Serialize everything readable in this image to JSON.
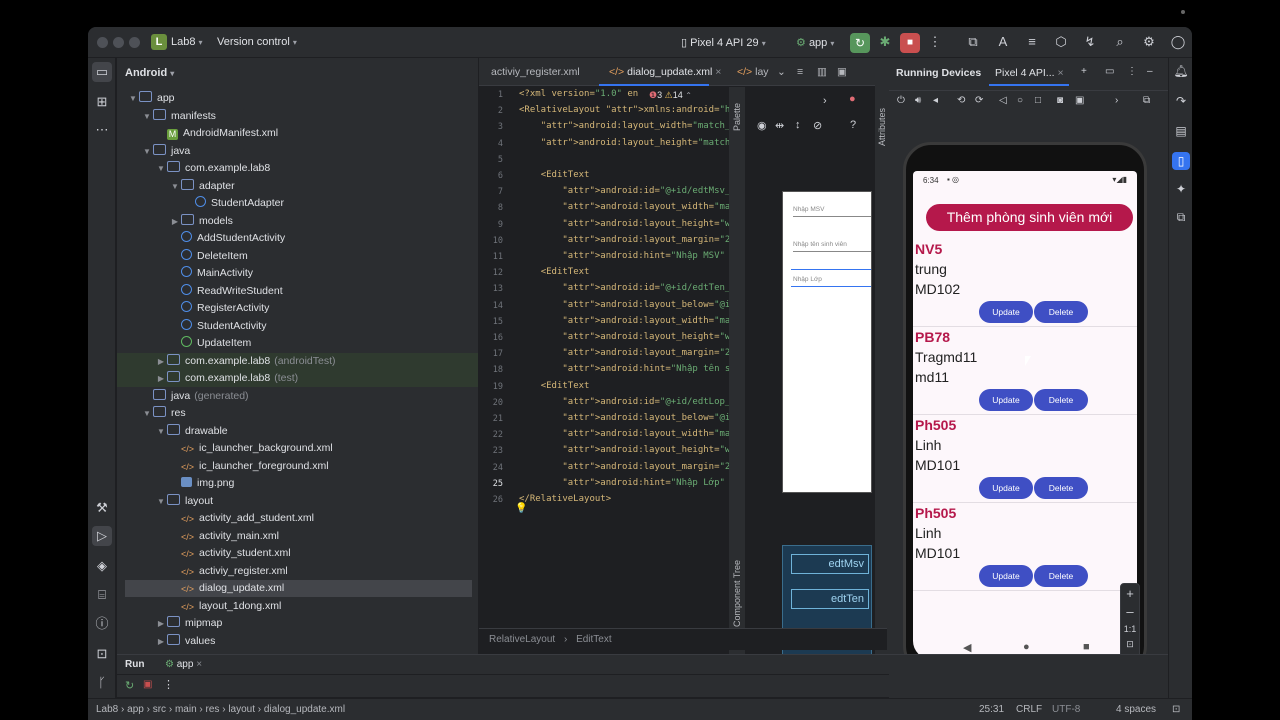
{
  "titlebar": {
    "project_badge": "L",
    "project_name": "Lab8",
    "vcs": "Version control",
    "device": "Pixel 4 API 29",
    "run_config": "app"
  },
  "project_panel": {
    "view": "Android",
    "tree": [
      {
        "label": "app",
        "suffix": "",
        "indent": 0,
        "icon": "folder",
        "arrow": "down"
      },
      {
        "label": "manifests",
        "suffix": "",
        "indent": 1,
        "icon": "folder",
        "arrow": "down"
      },
      {
        "label": "AndroidManifest.xml",
        "suffix": "",
        "indent": 2,
        "icon": "manifest",
        "arrow": ""
      },
      {
        "label": "java",
        "suffix": "",
        "indent": 1,
        "icon": "folder",
        "arrow": "down"
      },
      {
        "label": "com.example.lab8",
        "suffix": "",
        "indent": 2,
        "icon": "folder",
        "arrow": "down"
      },
      {
        "label": "adapter",
        "suffix": "",
        "indent": 3,
        "icon": "folder",
        "arrow": "down"
      },
      {
        "label": "StudentAdapter",
        "suffix": "",
        "indent": 4,
        "icon": "class",
        "arrow": ""
      },
      {
        "label": "models",
        "suffix": "",
        "indent": 3,
        "icon": "folder",
        "arrow": "right"
      },
      {
        "label": "AddStudentActivity",
        "suffix": "",
        "indent": 3,
        "icon": "class",
        "arrow": ""
      },
      {
        "label": "DeleteItem",
        "suffix": "",
        "indent": 3,
        "icon": "class",
        "arrow": ""
      },
      {
        "label": "MainActivity",
        "suffix": "",
        "indent": 3,
        "icon": "class",
        "arrow": ""
      },
      {
        "label": "ReadWriteStudent",
        "suffix": "",
        "indent": 3,
        "icon": "class",
        "arrow": ""
      },
      {
        "label": "RegisterActivity",
        "suffix": "",
        "indent": 3,
        "icon": "class",
        "arrow": ""
      },
      {
        "label": "StudentActivity",
        "suffix": "",
        "indent": 3,
        "icon": "class",
        "arrow": ""
      },
      {
        "label": "UpdateItem",
        "suffix": "",
        "indent": 3,
        "icon": "activity",
        "arrow": ""
      },
      {
        "label": "com.example.lab8",
        "suffix": "(androidTest)",
        "indent": 2,
        "icon": "folder",
        "arrow": "right",
        "test": true
      },
      {
        "label": "com.example.lab8",
        "suffix": "(test)",
        "indent": 2,
        "icon": "folder",
        "arrow": "right",
        "test": true
      },
      {
        "label": "java",
        "suffix": "(generated)",
        "indent": 1,
        "icon": "folder",
        "arrow": ""
      },
      {
        "label": "res",
        "suffix": "",
        "indent": 1,
        "icon": "folder",
        "arrow": "down"
      },
      {
        "label": "drawable",
        "suffix": "",
        "indent": 2,
        "icon": "folder",
        "arrow": "down"
      },
      {
        "label": "ic_launcher_background.xml",
        "suffix": "",
        "indent": 3,
        "icon": "xml",
        "arrow": ""
      },
      {
        "label": "ic_launcher_foreground.xml",
        "suffix": "",
        "indent": 3,
        "icon": "xml",
        "arrow": ""
      },
      {
        "label": "img.png",
        "suffix": "",
        "indent": 3,
        "icon": "png",
        "arrow": ""
      },
      {
        "label": "layout",
        "suffix": "",
        "indent": 2,
        "icon": "folder",
        "arrow": "down"
      },
      {
        "label": "activity_add_student.xml",
        "suffix": "",
        "indent": 3,
        "icon": "xml",
        "arrow": ""
      },
      {
        "label": "activity_main.xml",
        "suffix": "",
        "indent": 3,
        "icon": "xml",
        "arrow": ""
      },
      {
        "label": "activity_student.xml",
        "suffix": "",
        "indent": 3,
        "icon": "xml",
        "arrow": ""
      },
      {
        "label": "activiy_register.xml",
        "suffix": "",
        "indent": 3,
        "icon": "xml",
        "arrow": ""
      },
      {
        "label": "dialog_update.xml",
        "suffix": "",
        "indent": 3,
        "icon": "xml",
        "arrow": "",
        "selected": true
      },
      {
        "label": "layout_1dong.xml",
        "suffix": "",
        "indent": 3,
        "icon": "xml",
        "arrow": ""
      },
      {
        "label": "mipmap",
        "suffix": "",
        "indent": 2,
        "icon": "folder",
        "arrow": "right"
      },
      {
        "label": "values",
        "suffix": "",
        "indent": 2,
        "icon": "folder",
        "arrow": "right"
      }
    ]
  },
  "editor": {
    "tabs": [
      "activiy_register.xml",
      "dialog_update.xml",
      "lay"
    ],
    "warnings": "3",
    "warnings2": "14",
    "lines": [
      {
        "n": "1",
        "html": "<?xml version=\"1.0\" en"
      },
      {
        "n": "2",
        "html": "<RelativeLayout xmlns:android=\"http:/"
      },
      {
        "n": "3",
        "html": "    android:layout_width=\"match_paren"
      },
      {
        "n": "4",
        "html": "    android:layout_height=\"match_pare"
      },
      {
        "n": "5",
        "html": ""
      },
      {
        "n": "6",
        "html": "    <EditText"
      },
      {
        "n": "7",
        "html": "        android:id=\"@+id/edtMsv_dialo"
      },
      {
        "n": "8",
        "html": "        android:layout_width=\"match_p"
      },
      {
        "n": "9",
        "html": "        android:layout_height=\"wrap_c"
      },
      {
        "n": "10",
        "html": "        android:layout_margin=\"20dp\""
      },
      {
        "n": "11",
        "html": "        android:hint=\"Nhập MSV\" />"
      },
      {
        "n": "12",
        "html": "    <EditText"
      },
      {
        "n": "13",
        "html": "        android:id=\"@+id/edtTen_dialo"
      },
      {
        "n": "14",
        "html": "        android:layout_below=\"@id/edt"
      },
      {
        "n": "15",
        "html": "        android:layout_width=\"match_p"
      },
      {
        "n": "16",
        "html": "        android:layout_height=\"wrap_c"
      },
      {
        "n": "17",
        "html": "        android:layout_margin=\"20dp\""
      },
      {
        "n": "18",
        "html": "        android:hint=\"Nhập tên sinh v"
      },
      {
        "n": "19",
        "html": "    <EditText"
      },
      {
        "n": "20",
        "html": "        android:id=\"@+id/edtLop_dialo"
      },
      {
        "n": "21",
        "html": "        android:layout_below=\"@id/edt"
      },
      {
        "n": "22",
        "html": "        android:layout_width=\"match_p"
      },
      {
        "n": "23",
        "html": "        android:layout_height=\"wrap_c"
      },
      {
        "n": "24",
        "html": "        android:layout_margin=\"20dp\""
      },
      {
        "n": "25",
        "html": "        android:hint=\"Nhập Lớp\" />"
      },
      {
        "n": "26",
        "html": "</RelativeLayout>"
      }
    ],
    "current_line": "25",
    "breadcrumb": [
      "RelativeLayout",
      "EditText"
    ],
    "palette_label": "Palette",
    "component_tree_label": "Component Tree",
    "attributes_label": "Attributes"
  },
  "design_preview": {
    "hints": [
      "Nhập MSV",
      "Nhập tên sinh viên",
      "Nhập Lớp"
    ],
    "blueprint": [
      "edtMsv",
      "edtTen"
    ]
  },
  "running_devices": {
    "title": "Running Devices",
    "tab": "Pixel 4 API...",
    "phone": {
      "time": "6:34",
      "add_button": "Thêm phòng sinh viên mới",
      "items": [
        {
          "title": "NV5",
          "line2": "trung",
          "line3": "MD102"
        },
        {
          "title": "PB78",
          "line2": "Tragmd11",
          "line3": "md11"
        },
        {
          "title": "Ph505",
          "line2": "Linh",
          "line3": "MD101"
        },
        {
          "title": "Ph505",
          "line2": "Linh",
          "line3": "MD101"
        }
      ],
      "update_label": "Update",
      "delete_label": "Delete"
    },
    "zoom_label": "1:1"
  },
  "run": {
    "label": "Run",
    "tab": "app"
  },
  "statusbar": {
    "path": [
      "Lab8",
      "app",
      "src",
      "main",
      "res",
      "layout",
      "dialog_update.xml"
    ],
    "position": "25:31",
    "line_sep": "CRLF",
    "encoding": "UTF-8",
    "indent": "4 spaces"
  },
  "colors": {
    "accent": "#3574f0",
    "phone_primary": "#b5184b",
    "phone_button": "#3f4fc4"
  }
}
